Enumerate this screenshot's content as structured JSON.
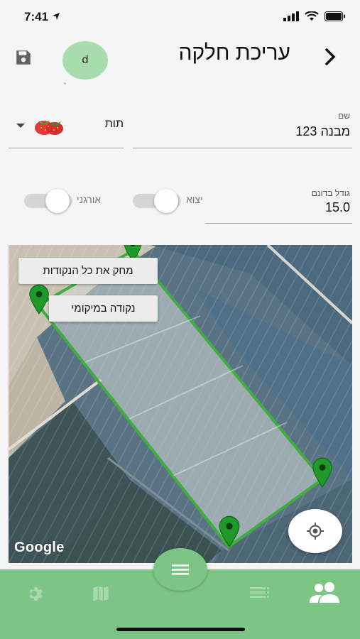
{
  "status": {
    "time": "7:41"
  },
  "header": {
    "title": "עריכת חלקה",
    "avatar_initial": "d"
  },
  "form": {
    "name_label": "שם",
    "name_value": "מבנה 123",
    "crop_value": "תות",
    "size_label": "גודל בדונם",
    "size_value": "15.0",
    "export_label": "יצוא",
    "organic_label": "אורגני",
    "export_on": false,
    "organic_on": false
  },
  "map": {
    "delete_all_label": "מחק את כל הנקודות",
    "my_location_point_label": "נקודה במיקומי",
    "attribution": "Google",
    "polygon_color": "#3fae3f",
    "marker_color": "#1f9a2a"
  },
  "nav": {
    "background": "#7dc585",
    "icons": [
      "gear-icon",
      "map-icon",
      "menu-icon",
      "list-icon",
      "people-icon"
    ]
  }
}
